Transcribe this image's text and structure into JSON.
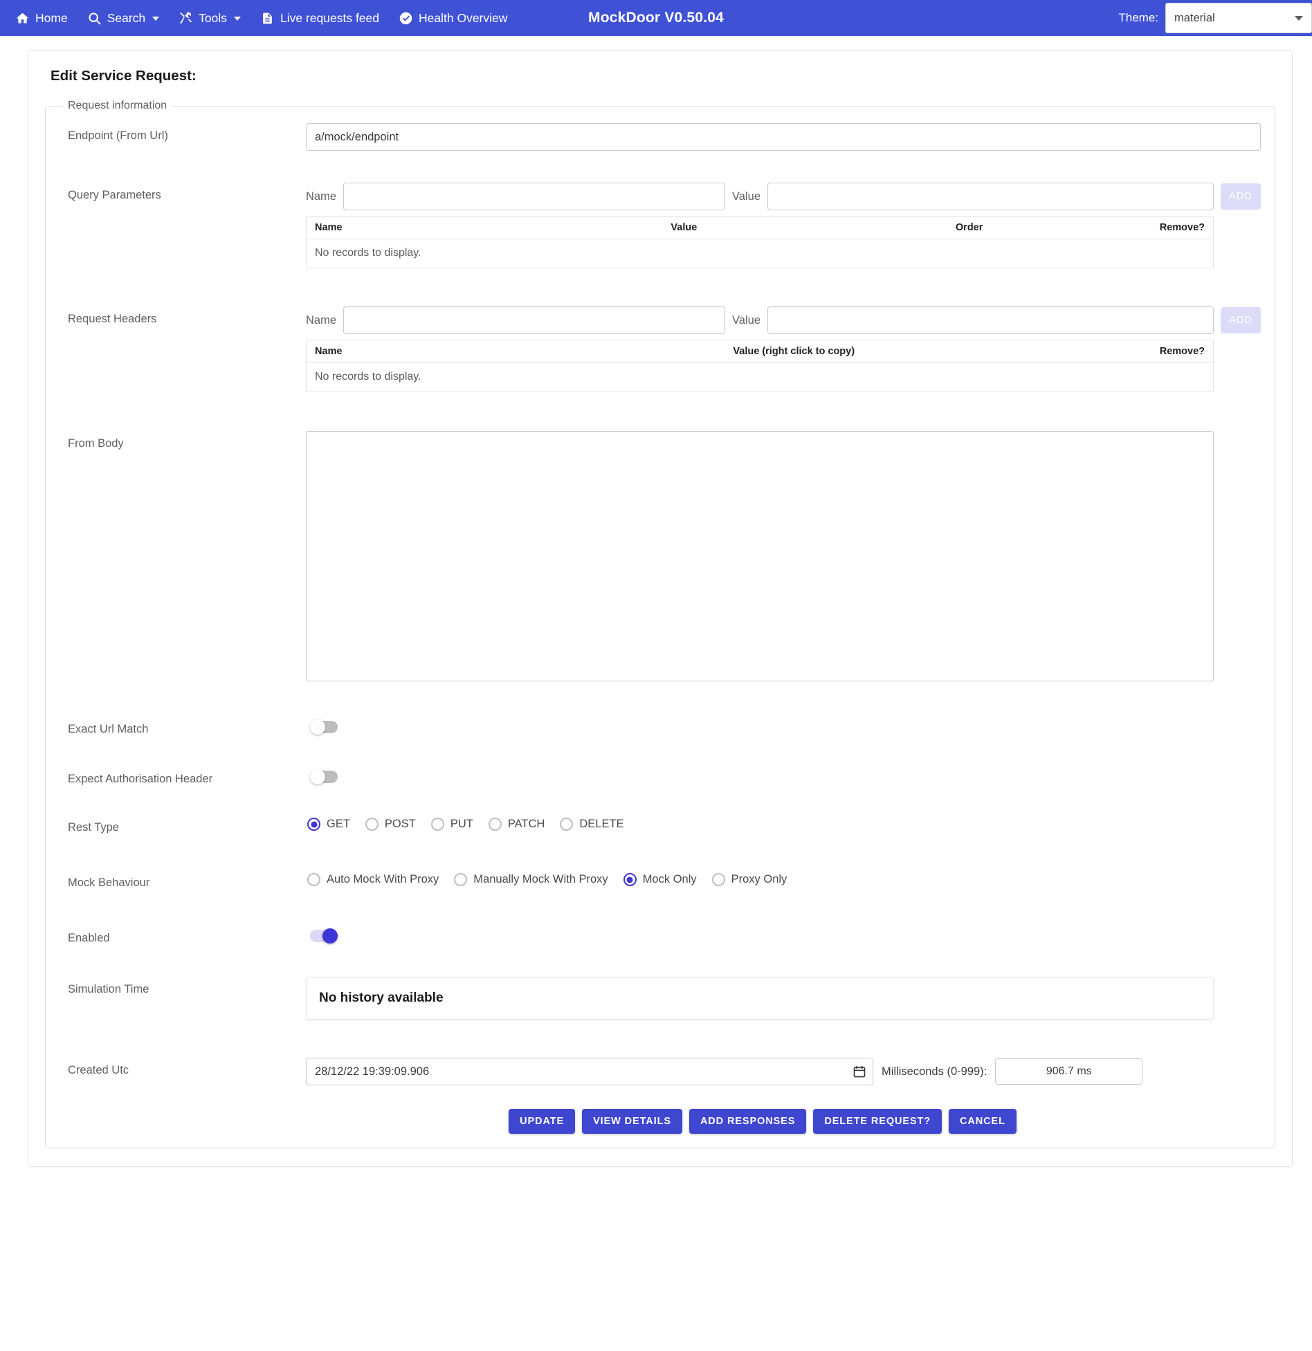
{
  "navbar": {
    "items": [
      {
        "label": "Home",
        "icon": "home-icon",
        "caret": false
      },
      {
        "label": "Search",
        "icon": "search-icon",
        "caret": true
      },
      {
        "label": "Tools",
        "icon": "tools-icon",
        "caret": true
      },
      {
        "label": "Live requests feed",
        "icon": "document-icon",
        "caret": false
      },
      {
        "label": "Health Overview",
        "icon": "check-circle-icon",
        "caret": false
      }
    ],
    "brand": "MockDoor V0.50.04",
    "theme_label": "Theme:",
    "theme_value": "material",
    "theme_options": [
      "material"
    ],
    "background_color": "#3f51d5"
  },
  "page": {
    "title": "Edit Service Request:",
    "group_legend": "Request information"
  },
  "endpoint": {
    "label": "Endpoint (From Url)",
    "value": "a/mock/endpoint",
    "placeholder": ""
  },
  "query_parameters": {
    "label": "Query Parameters",
    "name_label": "Name",
    "name_value": "",
    "name_placeholder": "",
    "value_label": "Value",
    "value_value": "",
    "value_placeholder": "",
    "add_label": "ADD",
    "columns": [
      "Name",
      "Value",
      "Order",
      "Remove?"
    ],
    "empty_message": "No records to display.",
    "rows": []
  },
  "request_headers": {
    "label": "Request Headers",
    "name_label": "Name",
    "name_value": "",
    "name_placeholder": "",
    "value_label": "Value",
    "value_value": "",
    "value_placeholder": "",
    "add_label": "ADD",
    "columns": [
      "Name",
      "Value (right click to copy)",
      "Remove?"
    ],
    "empty_message": "No records to display.",
    "rows": []
  },
  "from_body": {
    "label": "From Body",
    "value": "",
    "placeholder": ""
  },
  "exact_url_match": {
    "label": "Exact Url Match",
    "state": "off"
  },
  "expect_authorisation_header": {
    "label": "Expect Authorisation Header",
    "state": "off"
  },
  "rest_type": {
    "label": "Rest Type",
    "selected": "GET",
    "options": [
      "GET",
      "POST",
      "PUT",
      "PATCH",
      "DELETE"
    ]
  },
  "mock_behaviour": {
    "label": "Mock Behaviour",
    "selected": "Mock Only",
    "options": [
      "Auto Mock With Proxy",
      "Manually Mock With Proxy",
      "Mock Only",
      "Proxy Only"
    ]
  },
  "enabled": {
    "label": "Enabled",
    "state": "on"
  },
  "simulation_time": {
    "label": "Simulation Time",
    "message": "No history available"
  },
  "created_utc": {
    "label": "Created Utc",
    "value": "28/12/22 19:39:09.906",
    "milliseconds_label": "Milliseconds (0-999):",
    "milliseconds_value": "906.7 ms"
  },
  "actions": {
    "buttons": [
      "UPDATE",
      "VIEW DETAILS",
      "ADD RESPONSES",
      "DELETE REQUEST?",
      "CANCEL"
    ]
  },
  "colors": {
    "primary": "#3f51d5",
    "accent": "#3f34d6",
    "button": "#3f46cf",
    "add_button_disabled": "#dcdcf8"
  }
}
